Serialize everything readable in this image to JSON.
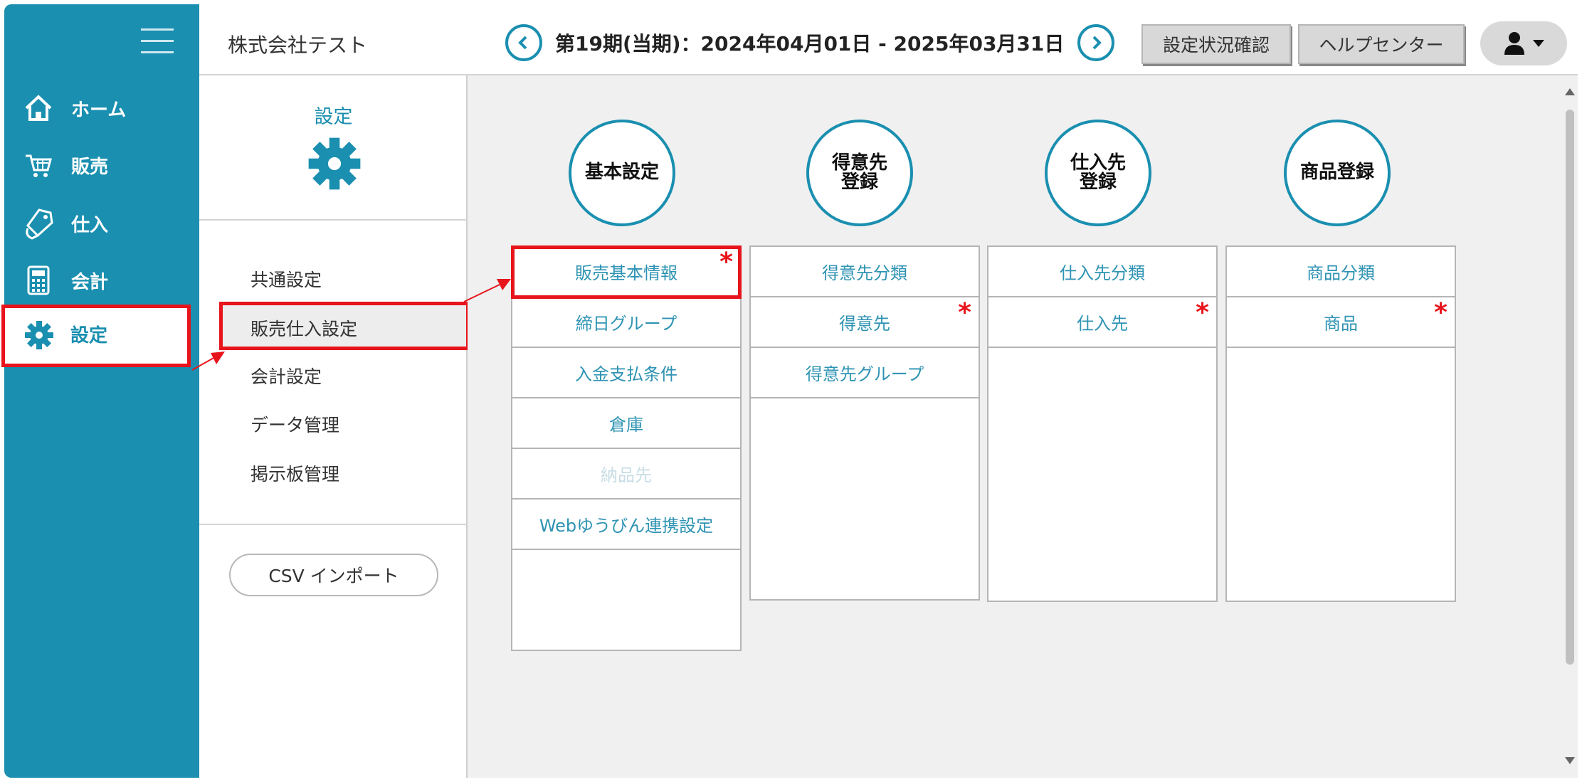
{
  "sidebar": {
    "menu_icon": "hamburger-icon",
    "items": [
      {
        "label": "ホーム",
        "icon": "home-icon"
      },
      {
        "label": "販売",
        "icon": "cart-icon"
      },
      {
        "label": "仕入",
        "icon": "purchase-tag-icon"
      },
      {
        "label": "会計",
        "icon": "calculator-icon"
      },
      {
        "label": "設定",
        "icon": "gear-icon",
        "selected": true
      }
    ]
  },
  "header": {
    "company": "株式会社テスト",
    "period": "第19期(当期)：2024年04月01日 - 2025年03月31日",
    "buttons": {
      "settings_status": "設定状況確認",
      "help": "ヘルプセンター"
    },
    "user_icon": "user-icon"
  },
  "submenu": {
    "title": "設定",
    "icon": "gear-icon",
    "items": [
      "共通設定",
      "販売仕入設定",
      "会計設定",
      "データ管理",
      "掲示板管理"
    ],
    "active_index": 1,
    "csv_button": "CSV インポート"
  },
  "categories": [
    {
      "title": "基本設定",
      "items": [
        {
          "label": "販売基本情報",
          "required": true
        },
        {
          "label": "締日グループ",
          "required": false
        },
        {
          "label": "入金支払条件",
          "required": false
        },
        {
          "label": "倉庫",
          "required": false
        },
        {
          "label": "納品先",
          "required": false,
          "disabled": true
        },
        {
          "label": "Webゆうびん連携設定",
          "required": false
        }
      ]
    },
    {
      "title_line1": "得意先",
      "title_line2": "登録",
      "items": [
        {
          "label": "得意先分類",
          "required": false
        },
        {
          "label": "得意先",
          "required": true
        },
        {
          "label": "得意先グループ",
          "required": false
        }
      ]
    },
    {
      "title_line1": "仕入先",
      "title_line2": "登録",
      "items": [
        {
          "label": "仕入先分類",
          "required": false
        },
        {
          "label": "仕入先",
          "required": true
        }
      ]
    },
    {
      "title": "商品登録",
      "items": [
        {
          "label": "商品分類",
          "required": false
        },
        {
          "label": "商品",
          "required": true
        }
      ]
    }
  ],
  "required_mark": "*",
  "colors": {
    "brand": "#1a8fb0",
    "highlight": "#e8141c",
    "background": "#f0f0f0"
  }
}
